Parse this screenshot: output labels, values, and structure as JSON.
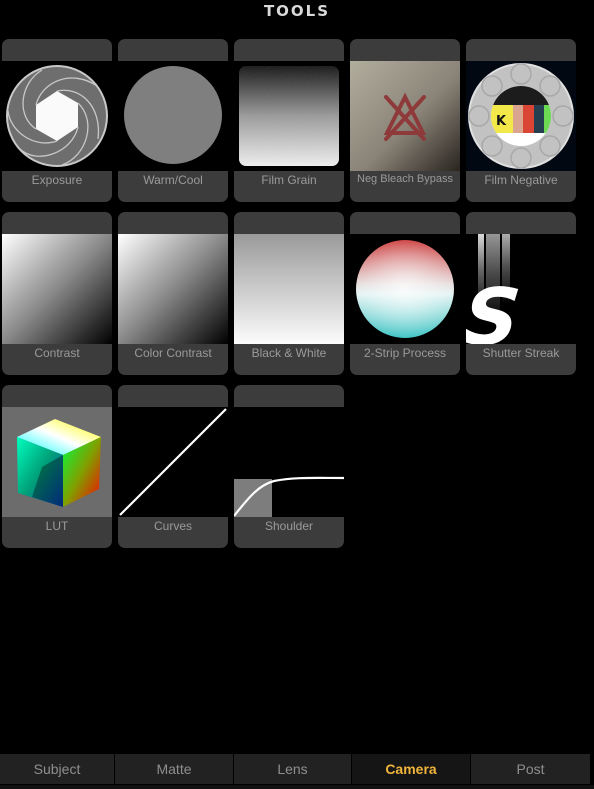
{
  "header": {
    "title": "TOOLS"
  },
  "tools": [
    {
      "label": "Exposure",
      "icon": "aperture-icon"
    },
    {
      "label": "Warm/Cool",
      "icon": "warm-cool-circle-icon"
    },
    {
      "label": "Film Grain",
      "icon": "film-grain-icon"
    },
    {
      "label": "Neg Bleach Bypass",
      "icon": "bleach-bypass-icon"
    },
    {
      "label": "Film Negative",
      "icon": "film-reel-icon"
    },
    {
      "label": "Contrast",
      "icon": "contrast-gradient-icon"
    },
    {
      "label": "Color Contrast",
      "icon": "color-contrast-gradient-icon"
    },
    {
      "label": "Black & White",
      "icon": "black-white-gradient-icon"
    },
    {
      "label": "2-Strip Process",
      "icon": "two-strip-sphere-icon"
    },
    {
      "label": "Shutter Streak",
      "icon": "shutter-streak-icon"
    },
    {
      "label": "LUT",
      "icon": "color-cube-icon"
    },
    {
      "label": "Curves",
      "icon": "curve-line-icon"
    },
    {
      "label": "Shoulder",
      "icon": "shoulder-curve-icon"
    }
  ],
  "tabs": [
    {
      "label": "Subject",
      "active": false
    },
    {
      "label": "Matte",
      "active": false
    },
    {
      "label": "Lens",
      "active": false
    },
    {
      "label": "Camera",
      "active": true
    },
    {
      "label": "Post",
      "active": false
    }
  ],
  "colors": {
    "background": "#000000",
    "card": "#3c3c3c",
    "label": "#9a9a9a",
    "active_tab": "#f0b43c",
    "tab": "#222222"
  }
}
